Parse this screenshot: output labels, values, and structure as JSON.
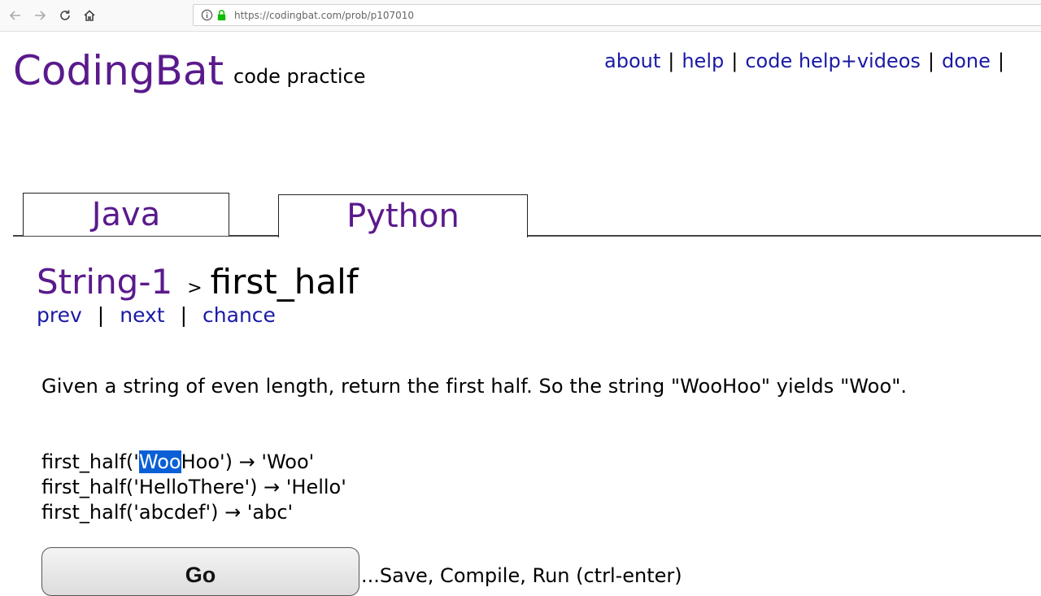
{
  "browser": {
    "url": "https://codingbat.com/prob/p107010"
  },
  "header": {
    "logo": "CodingBat",
    "tagline": "code practice",
    "nav": [
      "about",
      "help",
      "code help+videos",
      "done"
    ]
  },
  "tabs": [
    {
      "label": "Java",
      "active": false
    },
    {
      "label": "Python",
      "active": true
    }
  ],
  "problem": {
    "category": "String-1",
    "separator": ">",
    "title": "first_half",
    "nav": [
      "prev",
      "next",
      "chance"
    ],
    "description": "Given a string of even length, return the first half. So the string \"WooHoo\" yields \"Woo\".",
    "examples": [
      {
        "prefix": "first_half('",
        "selected": "Woo",
        "rest": "Hoo') → 'Woo'"
      },
      {
        "prefix": "first_half('HelloThere') → 'Hello'",
        "selected": "",
        "rest": ""
      },
      {
        "prefix": "first_half('abcdef') → 'abc'",
        "selected": "",
        "rest": ""
      }
    ]
  },
  "actions": {
    "go_label": "Go",
    "go_hint": "...Save, Compile, Run (ctrl-enter)"
  },
  "colors": {
    "logo": "#5a1a8c",
    "link": "#1a1aa6",
    "selection": "#0a5fd6"
  }
}
